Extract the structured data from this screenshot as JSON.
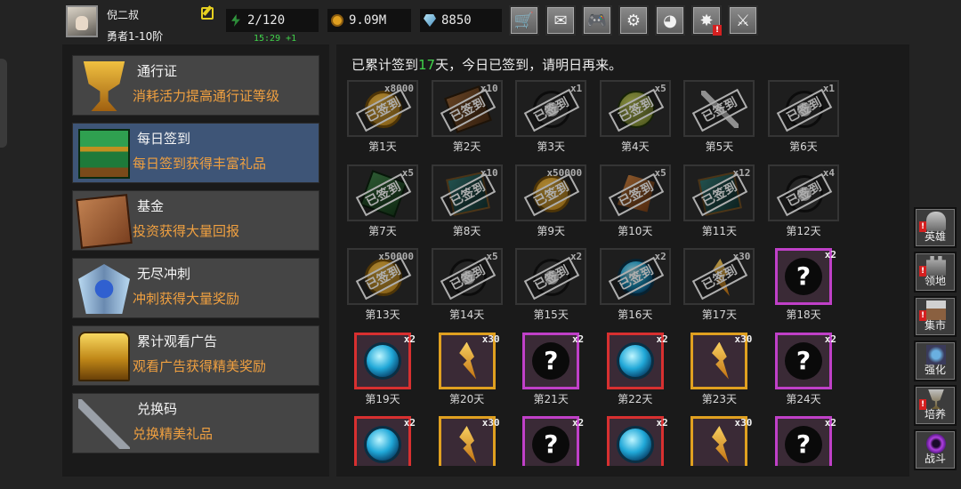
{
  "player": {
    "name": "倪二叔",
    "rank": "勇者1-10阶"
  },
  "stats": {
    "energy": "2/120",
    "timer": "15:29 +1",
    "gold": "9.09M",
    "gems": "8850"
  },
  "toolbar": [
    {
      "icon": "cart-icon",
      "glyph": "🛒"
    },
    {
      "icon": "mail-icon",
      "glyph": "✉"
    },
    {
      "icon": "gamepad-icon",
      "glyph": "🎮"
    },
    {
      "icon": "gear-icon",
      "glyph": "⚙"
    },
    {
      "icon": "color-wheel-icon",
      "glyph": "◕"
    },
    {
      "icon": "firework-icon",
      "glyph": "✸",
      "alert": "!"
    },
    {
      "icon": "crossed-swords-icon",
      "glyph": "⚔"
    }
  ],
  "menu": [
    {
      "title": "通行证",
      "desc": "消耗活力提高通行证等级",
      "icon": "trophy-cup-icon"
    },
    {
      "title": "每日签到",
      "desc": "每日签到获得丰富礼品",
      "icon": "green-book-stack-icon",
      "active": true
    },
    {
      "title": "基金",
      "desc": "投资获得大量回报",
      "icon": "treasure-map-icon"
    },
    {
      "title": "无尽冲刺",
      "desc": "冲刺获得大量奖励",
      "icon": "winged-crystal-icon"
    },
    {
      "title": "累计观看广告",
      "desc": "观看广告获得精美奖励",
      "icon": "golden-chest-icon"
    },
    {
      "title": "兑换码",
      "desc": "兑换精美礼品",
      "icon": "key-icon"
    }
  ],
  "signin": {
    "prefix": "已累计签到",
    "days": "17",
    "suffix": "天，今日已签到，请明日再来。",
    "stamp": "已签到"
  },
  "days": [
    {
      "label": "第1天",
      "qty": "x8000",
      "item": "gold-coin-icon",
      "claimed": true
    },
    {
      "label": "第2天",
      "qty": "x10",
      "item": "brown-scroll-icon",
      "claimed": true
    },
    {
      "label": "第3天",
      "qty": "x1",
      "item": "skull-token-icon",
      "claimed": true
    },
    {
      "label": "第4天",
      "qty": "x5",
      "item": "green-orb-icon",
      "claimed": true
    },
    {
      "label": "第5天",
      "qty": "",
      "item": "sword-icon",
      "claimed": true
    },
    {
      "label": "第6天",
      "qty": "x1",
      "item": "skull-token-icon",
      "claimed": true
    },
    {
      "label": "第7天",
      "qty": "x5",
      "item": "green-scroll-icon",
      "claimed": true
    },
    {
      "label": "第8天",
      "qty": "x10",
      "item": "teal-book-icon",
      "claimed": true
    },
    {
      "label": "第9天",
      "qty": "x50000",
      "item": "gold-coin-icon",
      "claimed": true
    },
    {
      "label": "第10天",
      "qty": "x5",
      "item": "amber-crystal-icon",
      "claimed": true
    },
    {
      "label": "第11天",
      "qty": "x12",
      "item": "teal-book-icon",
      "claimed": true
    },
    {
      "label": "第12天",
      "qty": "x4",
      "item": "skull-token-icon",
      "claimed": true
    },
    {
      "label": "第13天",
      "qty": "x50000",
      "item": "gold-coin-icon",
      "claimed": true
    },
    {
      "label": "第14天",
      "qty": "x5",
      "item": "skull-token-icon",
      "claimed": true
    },
    {
      "label": "第15天",
      "qty": "x2",
      "item": "skull-token-icon",
      "claimed": true
    },
    {
      "label": "第16天",
      "qty": "x2",
      "item": "cyan-orb-icon",
      "claimed": true
    },
    {
      "label": "第17天",
      "qty": "x30",
      "item": "amber-shard-icon",
      "claimed": true
    },
    {
      "label": "第18天",
      "qty": "x2",
      "item": "question-mark-icon",
      "claimed": false,
      "frame": "#c040c8"
    },
    {
      "label": "第19天",
      "qty": "x2",
      "item": "cyan-orb-icon",
      "claimed": false,
      "frame": "#d83030"
    },
    {
      "label": "第20天",
      "qty": "x30",
      "item": "amber-shard-icon",
      "claimed": false,
      "frame": "#e0a020"
    },
    {
      "label": "第21天",
      "qty": "x2",
      "item": "question-mark-icon",
      "claimed": false,
      "frame": "#c040c8"
    },
    {
      "label": "第22天",
      "qty": "x2",
      "item": "cyan-orb-icon",
      "claimed": false,
      "frame": "#d83030"
    },
    {
      "label": "第23天",
      "qty": "x30",
      "item": "amber-shard-icon",
      "claimed": false,
      "frame": "#e0a020"
    },
    {
      "label": "第24天",
      "qty": "x2",
      "item": "question-mark-icon",
      "claimed": false,
      "frame": "#c040c8"
    },
    {
      "label": "",
      "qty": "x2",
      "item": "cyan-orb-icon",
      "claimed": false,
      "frame": "#d83030"
    },
    {
      "label": "",
      "qty": "x30",
      "item": "amber-shard-icon",
      "claimed": false,
      "frame": "#e0a020"
    },
    {
      "label": "",
      "qty": "x2",
      "item": "question-mark-icon",
      "claimed": false,
      "frame": "#c040c8"
    },
    {
      "label": "",
      "qty": "x2",
      "item": "cyan-orb-icon",
      "claimed": false,
      "frame": "#d83030"
    },
    {
      "label": "",
      "qty": "x30",
      "item": "amber-shard-icon",
      "claimed": false,
      "frame": "#e0a020"
    },
    {
      "label": "",
      "qty": "x2",
      "item": "question-mark-icon",
      "claimed": false,
      "frame": "#c040c8"
    }
  ],
  "side": [
    {
      "label": "英雄",
      "icon": "knight-helmet-icon",
      "alert": "!"
    },
    {
      "label": "领地",
      "icon": "castle-icon",
      "alert": "!"
    },
    {
      "label": "集市",
      "icon": "market-stall-icon",
      "alert": "!"
    },
    {
      "label": "强化",
      "icon": "anvil-crystal-icon",
      "alert": ""
    },
    {
      "label": "培养",
      "icon": "goblet-icon",
      "alert": "!"
    },
    {
      "label": "战斗",
      "icon": "purple-portal-icon",
      "alert": ""
    }
  ],
  "colors": {
    "accent_orange": "#f0a040",
    "accent_green": "#41d44b",
    "active_menu": "#3e5577"
  }
}
